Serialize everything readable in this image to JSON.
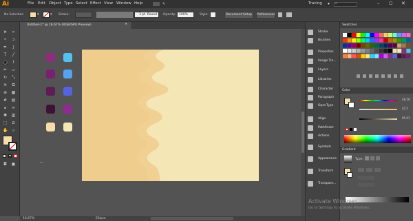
{
  "menubar": {
    "logo": "Ai",
    "items": [
      "File",
      "Edit",
      "Object",
      "Type",
      "Select",
      "Effect",
      "View",
      "Window",
      "Help"
    ],
    "workspace": "Tracing",
    "search_placeholder": ""
  },
  "control_bar": {
    "selection": "No Selection",
    "stroke_label": "Stroke:",
    "stroke_profile": "3 pt. Round",
    "opacity_label": "Opacity:",
    "opacity_value": "100%",
    "style_label": "Style:",
    "document_setup": "Document Setup",
    "preferences": "Preferences"
  },
  "document": {
    "tab_title": "Untitled-1* @ 16.67% (RGB/GPU Preview)",
    "zoom": "16.67%",
    "status_tool": "Ellipse"
  },
  "canvas_swatches": {
    "left": [
      "#8e2c7e",
      "#7a2070",
      "#5e1b55",
      "#3e1237",
      "#f5deaa"
    ],
    "right": [
      "#55c2ee",
      "#55a2ee",
      "#5563e0",
      "#8e2c92",
      "#f5e6b6"
    ]
  },
  "artboard": {
    "background": "#f5e6b6",
    "wave_color": "#f0d193",
    "mid_color": "#ebc27c"
  },
  "dock": {
    "items": [
      "Stroke",
      "Brushes",
      "Properties",
      "Image Tra...",
      "Layers",
      "Libraries",
      "Character",
      "Paragraph",
      "OpenType",
      "Align",
      "Pathfinder",
      "Actions",
      "Symbols",
      "Appearance",
      "Transform",
      "Transpare..."
    ]
  },
  "panels": {
    "swatches_tab": "Swatches",
    "color_tab": "Color",
    "color_values": [
      "48.59",
      "42.5",
      "95.61"
    ],
    "gradient_tab": "Gradient",
    "gradient_type_label": "Type:"
  },
  "watermark": {
    "title": "Activate Windows",
    "subtitle": "Go to Settings to activate Windows."
  }
}
